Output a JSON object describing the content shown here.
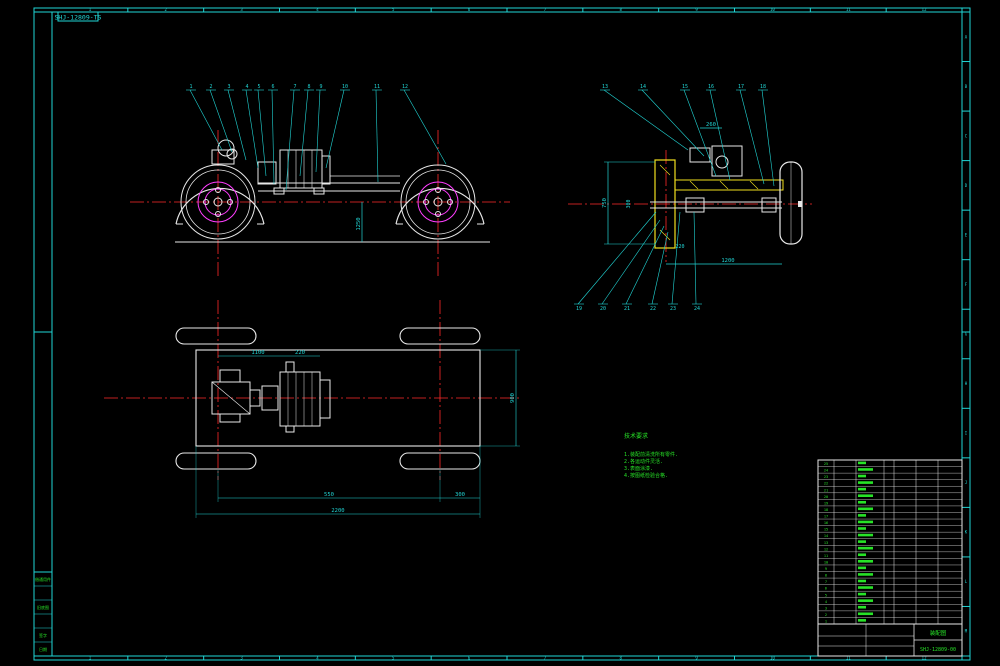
{
  "drawing": {
    "top_label": "SHJ-12809-TS",
    "title_box_id": "SHJ-12809-00",
    "colors": {
      "background": "#000000",
      "frame": "#21d6d6",
      "outline": "#e8e8e8",
      "center_line": "#ff2a2a",
      "hidden": "#ff3dff",
      "section": "#f2e01e",
      "notes": "#27e327"
    }
  },
  "border": {
    "column_numbers": [
      "1",
      "2",
      "3",
      "4",
      "5",
      "6",
      "7",
      "8",
      "9",
      "10",
      "11",
      "12"
    ],
    "row_letters": [
      "A",
      "B",
      "C",
      "D",
      "E",
      "F",
      "G",
      "H",
      "I",
      "J",
      "K",
      "L",
      "M"
    ]
  },
  "side_view": {
    "balloons": [
      "1",
      "2",
      "3",
      "4",
      "5",
      "6",
      "7",
      "8",
      "9",
      "10",
      "11",
      "12"
    ],
    "dims": {
      "height": "1250"
    }
  },
  "end_view": {
    "balloons_top": [
      "13",
      "14",
      "15",
      "16",
      "17",
      "18"
    ],
    "balloons_bottom": [
      "19",
      "20",
      "21",
      "22",
      "23",
      "24"
    ],
    "dims": {
      "width_top": "260",
      "height": "750",
      "track": "1200",
      "hub": "220",
      "sub": "300"
    }
  },
  "plan_view": {
    "dims": {
      "motor_offset": "1100",
      "motor_len": "220",
      "width": "900",
      "wheelbase": "550",
      "overhang": "300",
      "overall": "2200"
    }
  },
  "notes": {
    "title": "技术要求",
    "lines": [
      "1.装配前清洗所有零件.",
      "2.各运动件灵活.",
      "3.表面涂漆.",
      "4.按图纸检验合格."
    ]
  },
  "left_stamp": {
    "cells": [
      "借通用件",
      "",
      "旧底图",
      "",
      "签字",
      "日期"
    ]
  },
  "title_block": {
    "part_rows": [
      "1",
      "2",
      "3",
      "4",
      "5",
      "6",
      "7",
      "8",
      "9",
      "10",
      "11",
      "12",
      "13",
      "14",
      "15",
      "16",
      "17",
      "18",
      "19",
      "20",
      "21",
      "22",
      "23",
      "24",
      "25"
    ],
    "drawing_name": "装配图",
    "drawing_number": "SHJ-12809-00"
  }
}
